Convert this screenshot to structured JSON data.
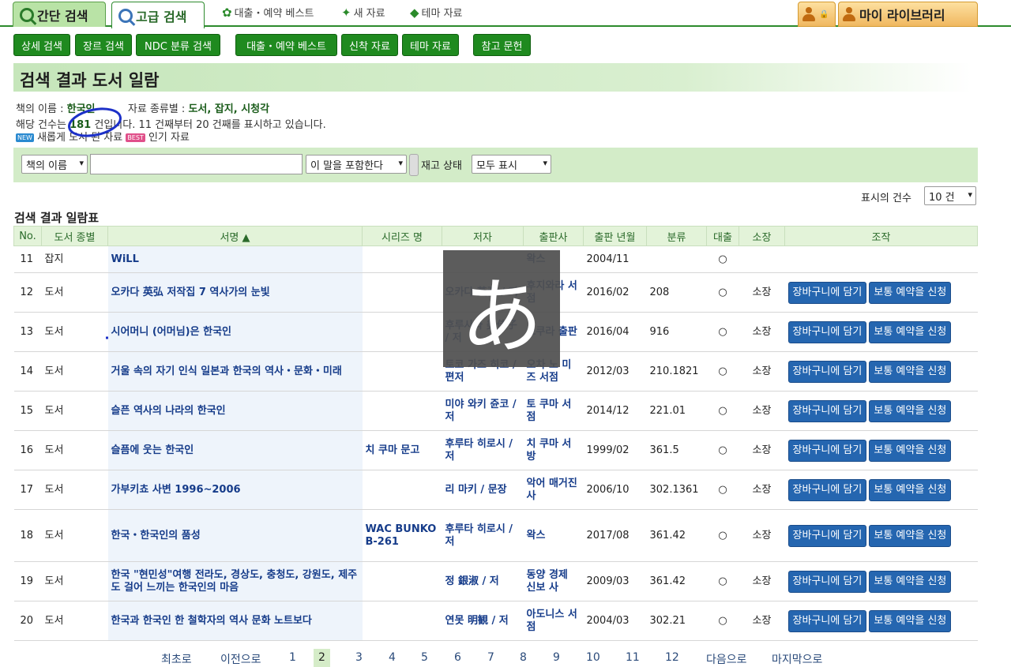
{
  "tabs": {
    "simple": "간단 검색",
    "advanced": "고급 검색"
  },
  "top_links": [
    "대출・예약 베스트",
    "새 자료",
    "테마 자료"
  ],
  "my_library": "마이 라이브러리",
  "nav_buttons": [
    "상세 검색",
    "장르 검색",
    "NDC 분류 검색",
    "대출・예약 베스트",
    "신착 자료",
    "테마 자료",
    "참고 문헌"
  ],
  "page_title": "검색 결과 도서 일람",
  "criteria": {
    "label_title": "책의 이름 :",
    "value_title": "한국인",
    "label_type": "자료 종류별 :",
    "value_type": "도서, 잡지, 시청각",
    "count_prefix": "해당 건수는",
    "count": "181",
    "count_suffix": "건입니다. 11 건째부터 20 건째를 표시하고 있습니다.",
    "new_badge": "NEW",
    "new_label": "새롭게 도서 된 자료",
    "best_badge": "BEST",
    "best_label": "인기 자료"
  },
  "search": {
    "field_select": "책의 이름",
    "query": "",
    "match_select": "이 말을 포함한다",
    "stock_label": "재고 상태",
    "stock_select": "모두 표시"
  },
  "display_count": {
    "label": "표시의 건수",
    "value": "10 건"
  },
  "table_caption": "검색 결과 일람표",
  "columns": [
    "No.",
    "도서 종별",
    "서명 ▲",
    "시리즈 명",
    "저자",
    "출판사",
    "출판 년월",
    "분류",
    "대출",
    "소장",
    "조작"
  ],
  "rows": [
    {
      "no": "11",
      "type": "잡지",
      "title": "WiLL",
      "series": "",
      "author": "",
      "publisher": "왁스",
      "date": "2004/11",
      "class": "",
      "loan": "○",
      "holding": "",
      "actions": false
    },
    {
      "no": "12",
      "type": "도서",
      "title": "오카다 英弘 저작집 7 역사가의 눈빛",
      "series": "",
      "author": "오카다 英弘 / 저",
      "publisher": "후지와라 서점",
      "date": "2016/02",
      "class": "208",
      "loan": "○",
      "holding": "소장",
      "actions": true
    },
    {
      "no": "13",
      "type": "도서",
      "title": "시어머니 (어머님)은 한국인",
      "series": "",
      "author": "후루사와 美佳子 / 저",
      "publisher": "오쿠라 출판",
      "date": "2016/04",
      "class": "916",
      "loan": "○",
      "holding": "소장",
      "actions": true
    },
    {
      "no": "14",
      "type": "도서",
      "title": "거울 속의 자기 인식 일본과 한국의 역사・문화・미래",
      "series": "",
      "author": "토코 가즈 히코 / 편저",
      "publisher": "오차 노 미즈 서점",
      "date": "2012/03",
      "class": "210.1821",
      "loan": "○",
      "holding": "소장",
      "actions": true
    },
    {
      "no": "15",
      "type": "도서",
      "title": "슬픈 역사의 나라의 한국인",
      "series": "",
      "author": "미야 와키 쥰코 / 저",
      "publisher": "토 쿠마 서점",
      "date": "2014/12",
      "class": "221.01",
      "loan": "○",
      "holding": "소장",
      "actions": true
    },
    {
      "no": "16",
      "type": "도서",
      "title": "슬픔에 웃는 한국인",
      "series": "치 쿠마 문고",
      "author": "후루타 히로시 / 저",
      "publisher": "치 쿠마 서방",
      "date": "1999/02",
      "class": "361.5",
      "loan": "○",
      "holding": "소장",
      "actions": true
    },
    {
      "no": "17",
      "type": "도서",
      "title": "가부키쵸 사변 1996~2006",
      "series": "",
      "author": "리 마키 / 문장",
      "publisher": "악어 매거진 사",
      "date": "2006/10",
      "class": "302.1361",
      "loan": "○",
      "holding": "소장",
      "actions": true
    },
    {
      "no": "18",
      "type": "도서",
      "title": "한국・한국인의 품성",
      "series": "WAC BUNKO B-261",
      "author": "후루타 히로시 / 저",
      "publisher": "왁스",
      "date": "2017/08",
      "class": "361.42",
      "loan": "○",
      "holding": "소장",
      "actions": true
    },
    {
      "no": "19",
      "type": "도서",
      "title": "한국 \"현민성\"여행 전라도, 경상도, 충청도, 강원도, 제주도 걸어 느끼는 한국인의 마음",
      "series": "",
      "author": "정 銀淑 / 저",
      "publisher": "동양 경제 신보 사",
      "date": "2009/03",
      "class": "361.42",
      "loan": "○",
      "holding": "소장",
      "actions": true
    },
    {
      "no": "20",
      "type": "도서",
      "title": "한국과 한국인 한 철학자의 역사 문화 노트보다",
      "series": "",
      "author": "연못 明観 / 저",
      "publisher": "아도니스 서점",
      "date": "2004/03",
      "class": "302.21",
      "loan": "○",
      "holding": "소장",
      "actions": true
    }
  ],
  "action_labels": {
    "cart": "장바구니에 담기",
    "reserve": "보통 예약을 신청"
  },
  "overlay_glyph": "あ",
  "pager": {
    "first": "최초로",
    "prev": "이전으로",
    "pages": [
      "1",
      "2",
      "3",
      "4",
      "5",
      "6",
      "7",
      "8",
      "9",
      "10",
      "11",
      "12"
    ],
    "current": "2",
    "next": "다음으로",
    "last": "마지막으로"
  }
}
